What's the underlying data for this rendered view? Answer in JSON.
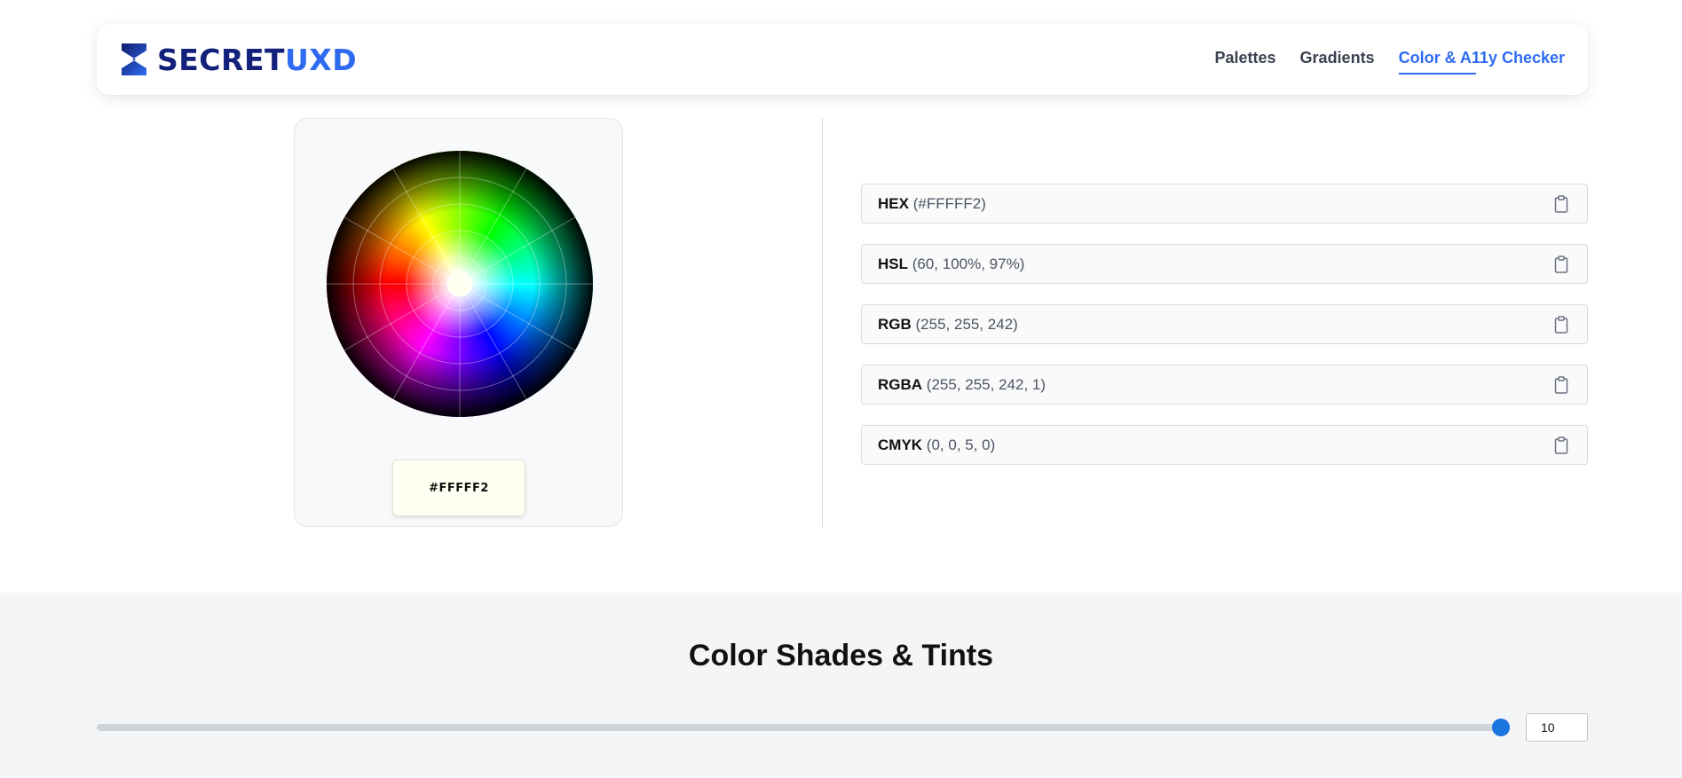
{
  "brand": {
    "name_part1": "SECRET",
    "name_part2": "UXD"
  },
  "nav": {
    "links": [
      {
        "label": "Palettes"
      },
      {
        "label": "Gradients"
      },
      {
        "label": "Color & A11y Checker",
        "active": true
      }
    ]
  },
  "picker": {
    "selected_hex": "#FFFFF2",
    "selected_color": "#fffff2"
  },
  "formats": [
    {
      "name": "HEX",
      "value": "(#FFFFF2)"
    },
    {
      "name": "HSL",
      "value": "(60, 100%, 97%)"
    },
    {
      "name": "RGB",
      "value": "(255, 255, 242)"
    },
    {
      "name": "RGBA",
      "value": "(255, 255, 242, 1)"
    },
    {
      "name": "CMYK",
      "value": "(0, 0, 5, 0)"
    }
  ],
  "shades": {
    "title": "Color Shades & Tints",
    "count_value": "10"
  },
  "colors": {
    "accent": "#2f6bf1",
    "brand_dark": "#13217a",
    "slider": "#1a74e0"
  },
  "icons": {
    "copy": "clipboard-icon",
    "logo": "logo-mark-icon"
  }
}
